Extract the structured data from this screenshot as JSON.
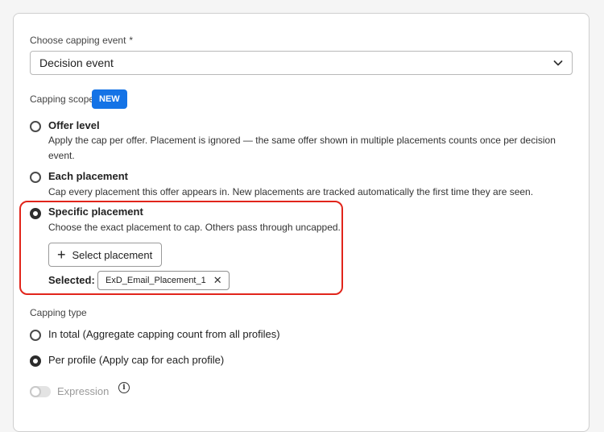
{
  "capping_event": {
    "label": "Choose capping event",
    "required_marker": "*",
    "selected_value": "Decision event"
  },
  "capping_scope": {
    "label": "Capping scope",
    "badge": "NEW",
    "options": [
      {
        "title": "Offer level",
        "description": "Apply the cap per offer. Placement is ignored — the same offer shown in multiple placements counts once per decision event.",
        "selected": false
      },
      {
        "title": "Each placement",
        "description": "Cap every placement this offer appears in. New placements are tracked automatically the first time they are seen.",
        "selected": false
      },
      {
        "title": "Specific placement",
        "description": "Choose the exact placement to cap. Others pass through uncapped.",
        "selected": true
      }
    ],
    "select_button_label": "Select placement",
    "selected_label": "Selected:",
    "selected_tag": "ExD_Email_Placement_1"
  },
  "capping_type": {
    "label": "Capping type",
    "options": [
      {
        "label": "In total (Aggregate capping count from all profiles)",
        "selected": false
      },
      {
        "label": "Per profile (Apply cap for each profile)",
        "selected": true
      }
    ]
  },
  "expression": {
    "label": "Expression",
    "enabled": false,
    "info_glyph": "i"
  },
  "colors": {
    "accent": "#1473e6",
    "highlight": "#e1251b"
  }
}
